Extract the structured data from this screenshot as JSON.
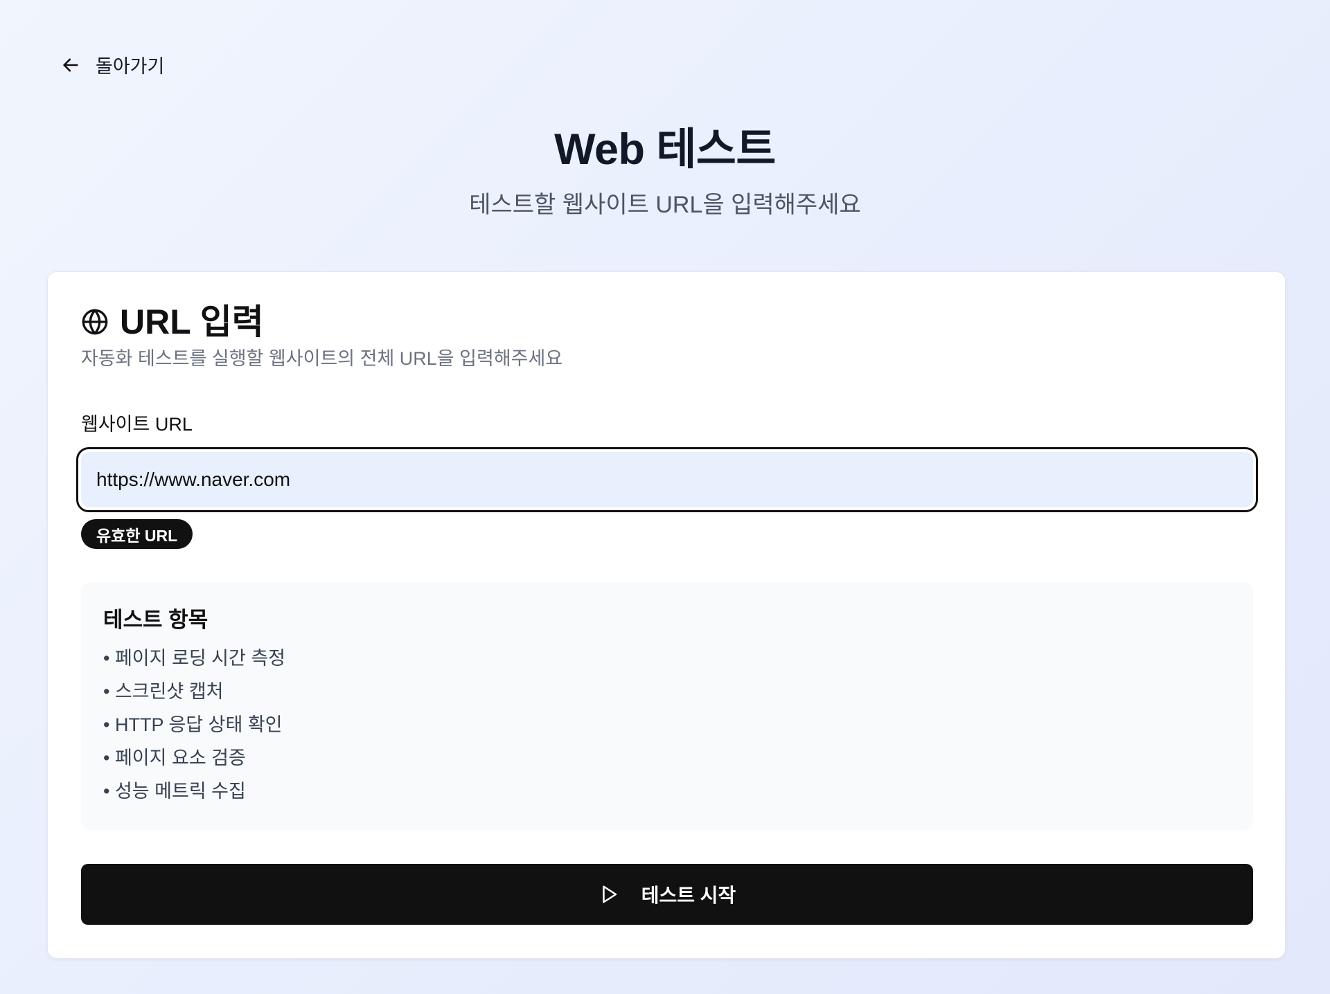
{
  "nav": {
    "back_label": "돌아가기",
    "back_icon": "arrow-left-icon"
  },
  "header": {
    "title": "Web 테스트",
    "subtitle": "테스트할 웹사이트 URL을 입력해주세요"
  },
  "card": {
    "icon": "globe-icon",
    "title": "URL 입력",
    "description": "자동화 테스트를 실행할 웹사이트의 전체 URL을 입력해주세요",
    "field_label": "웹사이트 URL",
    "url_value": "https://www.naver.com",
    "validation_badge": "유효한 URL",
    "test_items": {
      "title": "테스트 항목",
      "items": [
        "• 페이지 로딩 시간 측정",
        "• 스크린샷 캡처",
        "• HTTP 응답 상태 확인",
        "• 페이지 요소 검증",
        "• 성능 메트릭 수집"
      ]
    },
    "start_button": {
      "label": "테스트 시작",
      "icon": "play-icon"
    }
  },
  "colors": {
    "background": "#eaf0fd",
    "card": "#ffffff",
    "primary": "#111111",
    "input_fill": "#e8effd",
    "muted_text": "#6b7280",
    "items_box": "#f8fafc"
  }
}
